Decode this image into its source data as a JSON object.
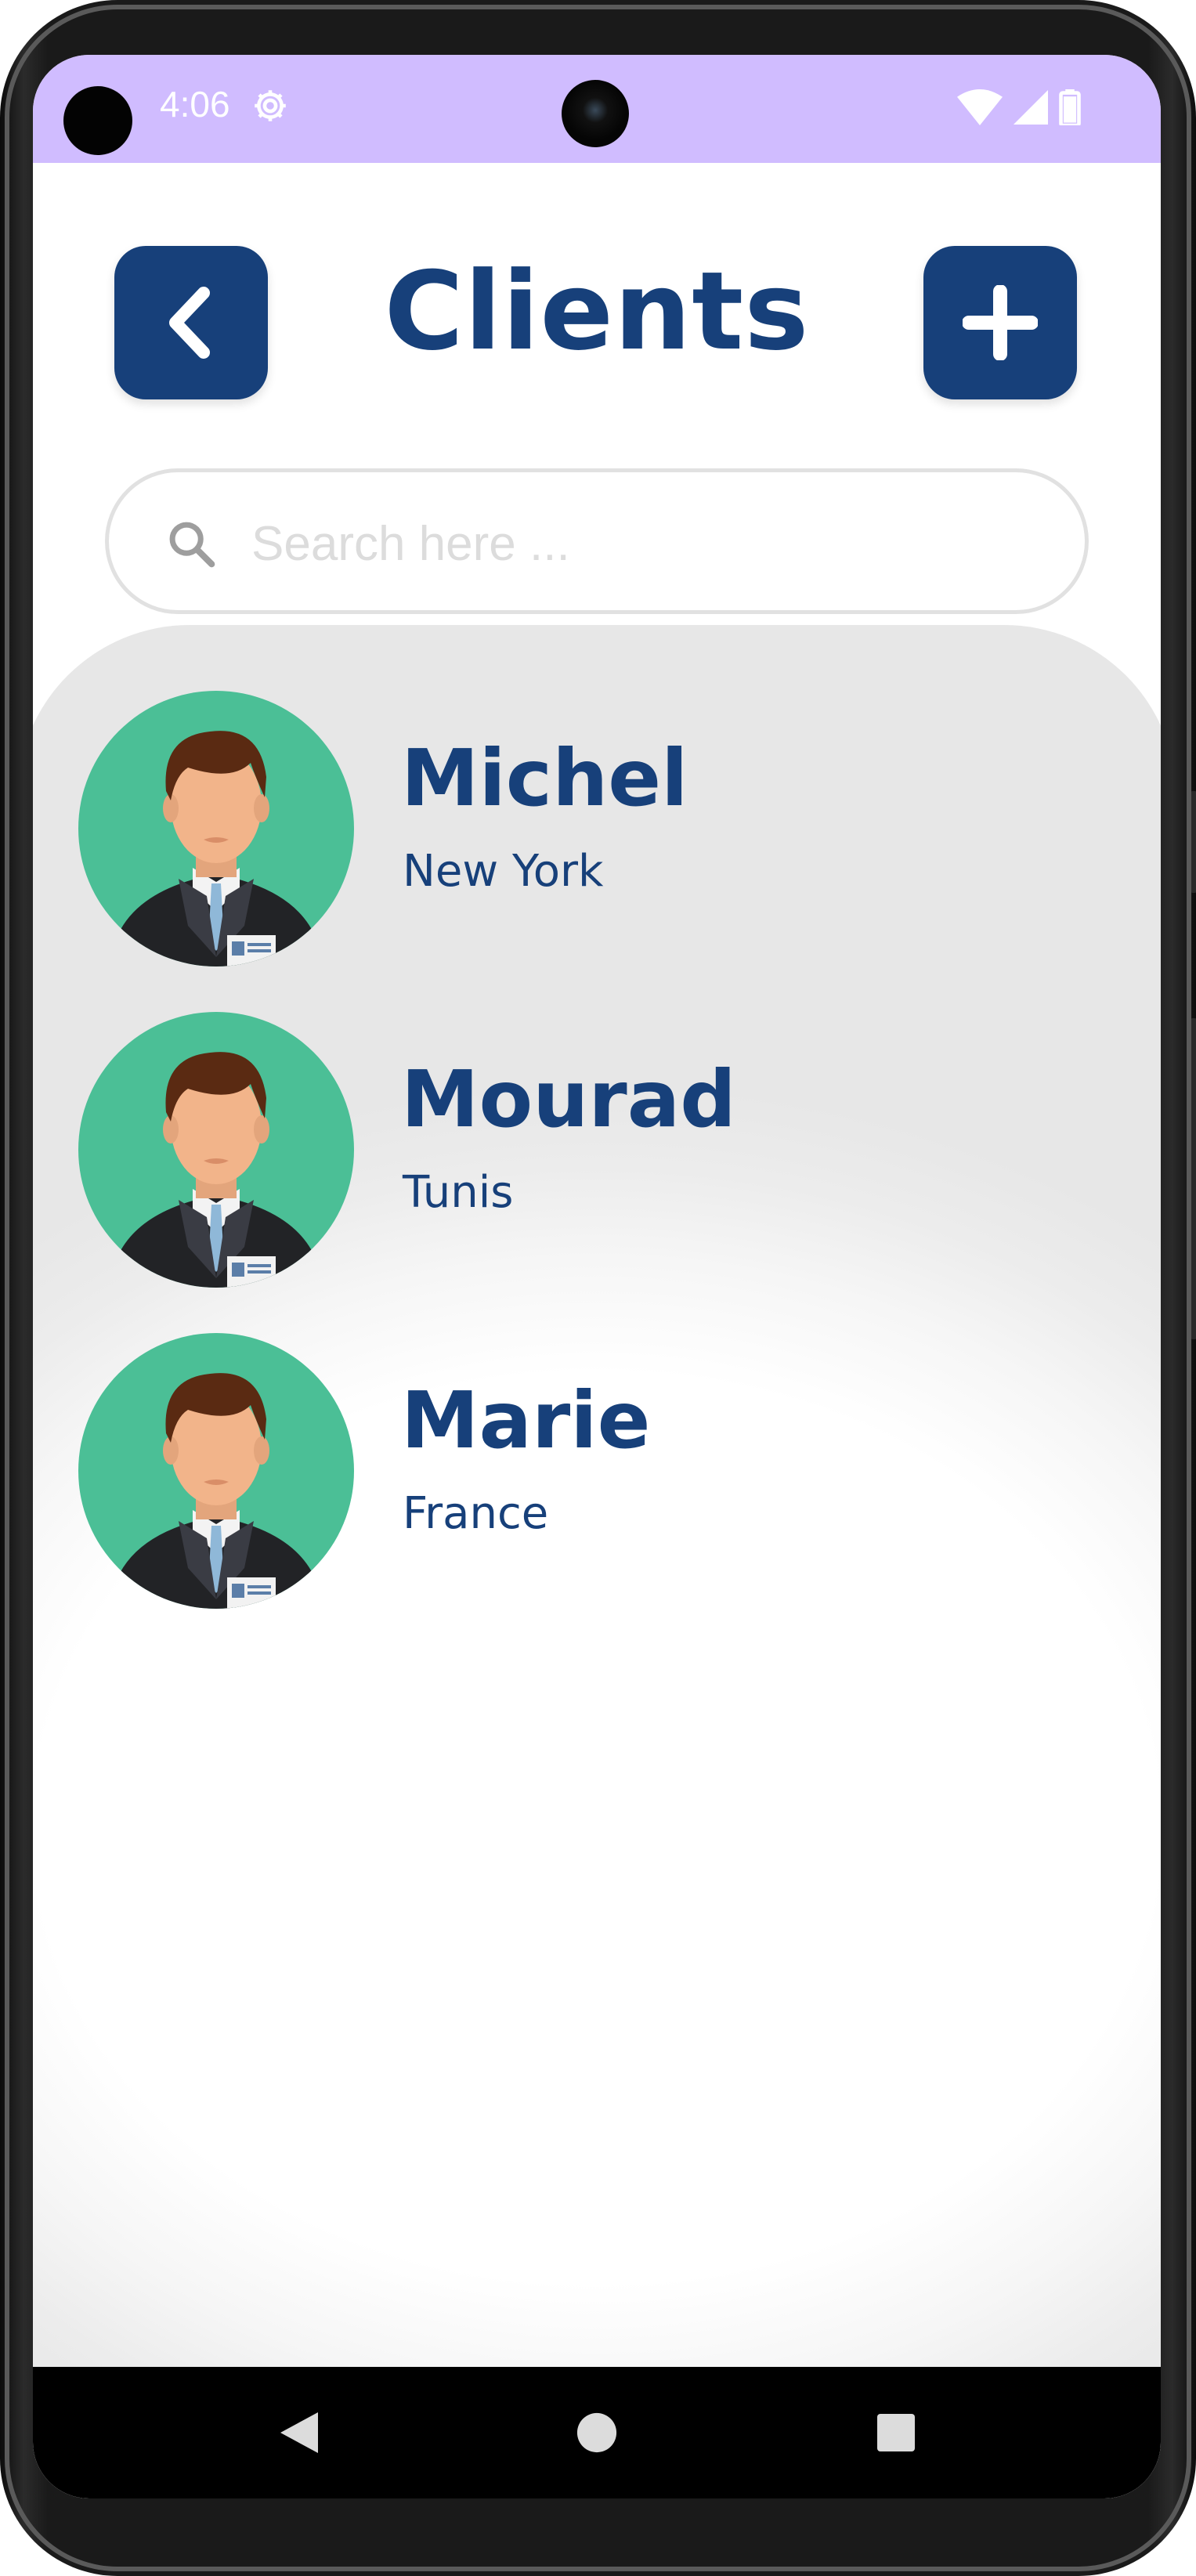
{
  "status_bar": {
    "time": "4:06",
    "background": "#d0bcff",
    "icons": [
      "settings-icon",
      "wifi-icon",
      "signal-icon",
      "battery-icon"
    ]
  },
  "header": {
    "title": "Clients",
    "back_icon": "chevron-left-icon",
    "add_icon": "plus-icon",
    "button_color": "#17407a"
  },
  "search": {
    "placeholder": "Search here ...",
    "value": "",
    "icon": "search-icon"
  },
  "clients": [
    {
      "name": "Michel",
      "location": "New York",
      "avatar": "businessman-avatar"
    },
    {
      "name": "Mourad",
      "location": "Tunis",
      "avatar": "businessman-avatar"
    },
    {
      "name": "Marie",
      "location": "France",
      "avatar": "businessman-avatar"
    }
  ],
  "navigation": {
    "buttons": [
      "back-triangle-icon",
      "home-circle-icon",
      "recents-square-icon"
    ]
  },
  "colors": {
    "primary": "#17407a",
    "avatar_bg": "#4bbf96",
    "list_bg": "#e7e7e7"
  }
}
